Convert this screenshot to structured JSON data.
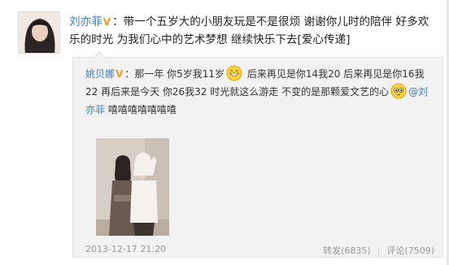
{
  "post": {
    "author": "刘亦菲",
    "verified_badge": "V",
    "text": "：带一个五岁大的小朋友玩是不是很烦 谢谢你儿时的陪伴 好多欢乐的时光 为我们心中的艺术梦想 继续快乐下去[爱心传递]"
  },
  "repost": {
    "author": "姚贝娜",
    "verified_badge": "V",
    "text_part1": "：那一年 你5岁我11岁",
    "text_part2": " 后来再见是你14我20 后来再见是你16我22 再后来是今天 你26我32 时光就这么游走 不变的是那颗爱文艺的心",
    "mention": "@刘亦菲",
    "text_part3": " 嘻嘻嘻嘻嘻嘻嘻",
    "timestamp": "2013-12-17 21:20",
    "repost_label": "转发(6835)",
    "comment_label": "评论(7509)"
  }
}
